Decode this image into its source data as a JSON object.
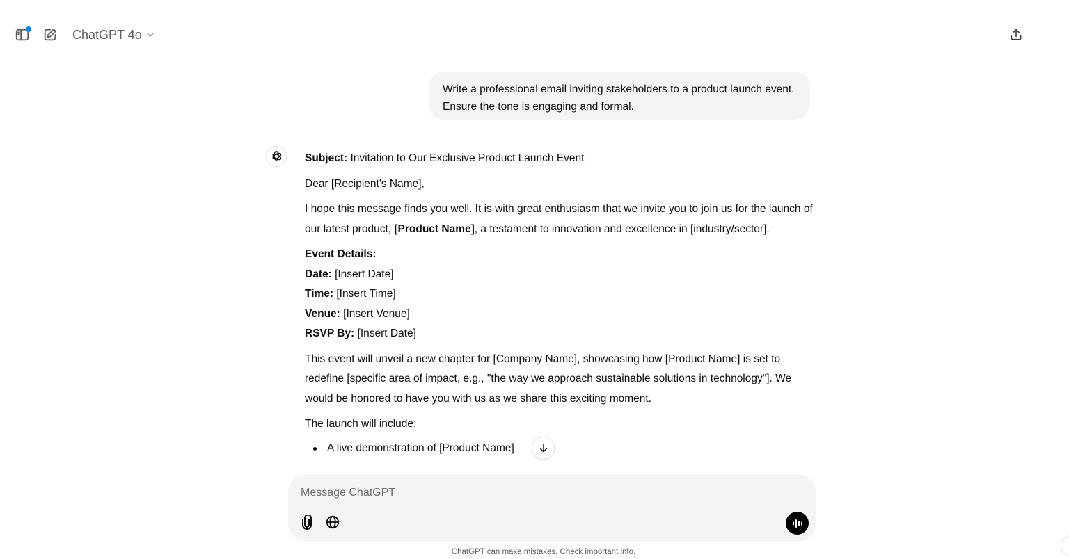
{
  "header": {
    "model_name": "ChatGPT 4o",
    "sidebar_icon": "sidebar-icon",
    "new_chat_icon": "new-chat-icon",
    "share_icon": "share-icon",
    "notification_color": "#0285ff"
  },
  "user_message": {
    "text": "Write a professional email inviting stakeholders to a product launch event. Ensure the tone is engaging and formal."
  },
  "assistant": {
    "subject_label": "Subject:",
    "subject_text": " Invitation to Our Exclusive Product Launch Event",
    "greeting": "Dear [Recipient's Name],",
    "intro_before": "I hope this message finds you well. It is with great enthusiasm that we invite you to join us for the launch of our latest product, ",
    "intro_product": "[Product Name]",
    "intro_after": ", a testament to innovation and excellence in [industry/sector].",
    "event_details_heading": "Event Details:",
    "details": [
      {
        "label": "Date:",
        "value": " [Insert Date]"
      },
      {
        "label": "Time:",
        "value": " [Insert Time]"
      },
      {
        "label": "Venue:",
        "value": " [Insert Venue]"
      },
      {
        "label": "RSVP By:",
        "value": " [Insert Date]"
      }
    ],
    "unveil_paragraph": "This event will unveil a new chapter for [Company Name], showcasing how [Product Name] is set to redefine [specific area of impact, e.g., \"the way we approach sustainable solutions in technology\"]. We would be honored to have you with us as we share this exciting moment.",
    "launch_includes": "The launch will include:",
    "bullets": [
      "A live demonstration of [Product Name]"
    ]
  },
  "composer": {
    "placeholder": "Message ChatGPT",
    "attach_icon": "paperclip-icon",
    "web_icon": "globe-icon",
    "voice_icon": "voice-mode-icon"
  },
  "footer": {
    "disclaimer": "ChatGPT can make mistakes. Check important info."
  }
}
